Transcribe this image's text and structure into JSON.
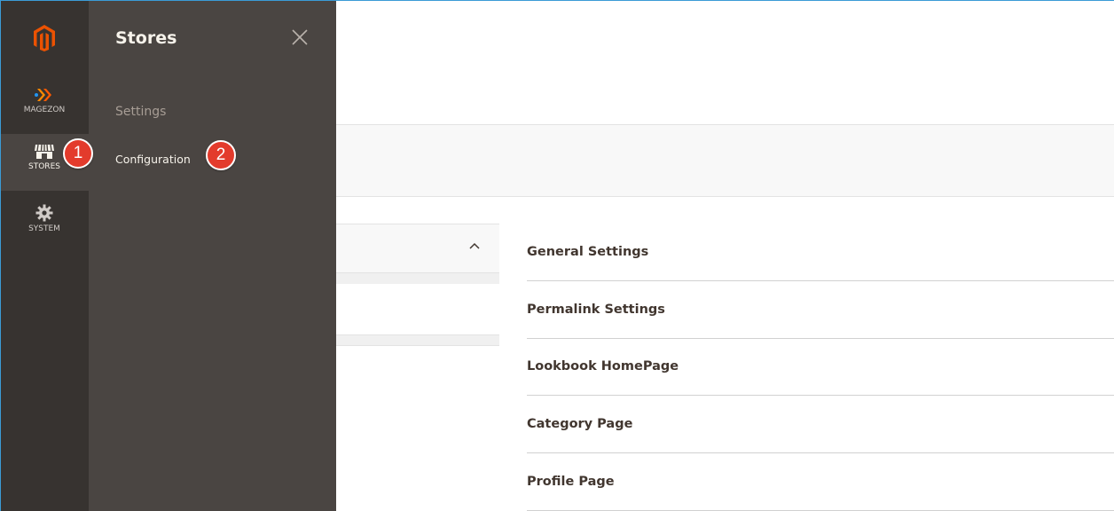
{
  "rail": {
    "items": [
      {
        "id": "magezon",
        "label": "MAGEZON",
        "icon": "magezon-chevrons-icon"
      },
      {
        "id": "stores",
        "label": "STORES",
        "icon": "store-awning-icon",
        "active": true
      },
      {
        "id": "system",
        "label": "SYSTEM",
        "icon": "gear-icon"
      }
    ]
  },
  "flyout": {
    "title": "Stores",
    "section_title": "Settings",
    "link": "Configuration"
  },
  "badges": {
    "step1": "1",
    "step2": "2"
  },
  "sections": [
    "General Settings",
    "Permalink Settings",
    "Lookbook HomePage",
    "Category Page",
    "Profile Page"
  ],
  "colors": {
    "rail_bg": "#373330",
    "flyout_bg": "#4a4542",
    "brand_orange": "#eb5202",
    "badge_red": "#e33b2c"
  }
}
